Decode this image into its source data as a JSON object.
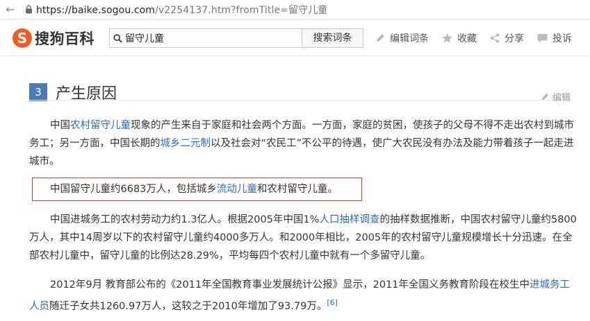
{
  "browser": {
    "url_host": "https://baike.sogou.com",
    "url_path": "/v2254137.htm?fromTitle=留守儿童"
  },
  "header": {
    "logo_letter": "S",
    "logo_text": "搜狗百科",
    "search_value": "留守儿童",
    "search_button": "搜索词条",
    "tools": [
      {
        "label": "编辑词条",
        "icon": "pencil-icon"
      },
      {
        "label": "收藏",
        "icon": "star-icon"
      },
      {
        "label": "分享",
        "icon": "share-icon"
      },
      {
        "label": "投诉",
        "icon": "chat-icon"
      }
    ]
  },
  "section": {
    "number": "3",
    "title": "产生原因",
    "edit_label": "编辑"
  },
  "paragraphs": {
    "p1": {
      "t1": "中国",
      "l1": "农村留守儿童",
      "t2": "现象的产生来自于家庭和社会两个方面。一方面，家庭的贫困，使孩子的父母不得不走出农村到城市务工；另一方面，中国长期的",
      "l2": "城乡二元制",
      "t3": "以及社会对“农民工”不公平的待遇，使广大农民没有办法及能力带着孩子一起走进城市。"
    },
    "p2": {
      "t1": "中国留守儿童约6683万人，包括城乡",
      "l1": "流动儿童",
      "t2": "和农村留守儿童。"
    },
    "p3": {
      "t1": "中国进城务工的农村劳动力约1.3亿人。根据2005年中国1%",
      "l1": "人口抽样调查",
      "t2": "的抽样数据推断，中国农村留守儿童约5800万人，其中14周岁以下的农村留守儿童约4000多万人。和2000年相比，2005年的农村留守儿童规模增长十分迅速。在全部农村儿童中，留守儿童的比例达28.29%，平均每四个农村儿童中就有一个多留守儿童。"
    },
    "p4": {
      "t1": "2012年9月 教育部公布的《2011年全国教育事业发展统计公报》显示，2011年全国义务教育阶段在校生中",
      "l1": "进城务工人员",
      "t2": "随迁子女共1260.97万人，这较之于2010年增加了93.79万。",
      "ref": "[6]"
    }
  },
  "colors": {
    "logo": "#f25d1f",
    "link": "#2e6bb5",
    "section_badge": "#4b7bb5",
    "highlight_border": "#d83a3a"
  }
}
